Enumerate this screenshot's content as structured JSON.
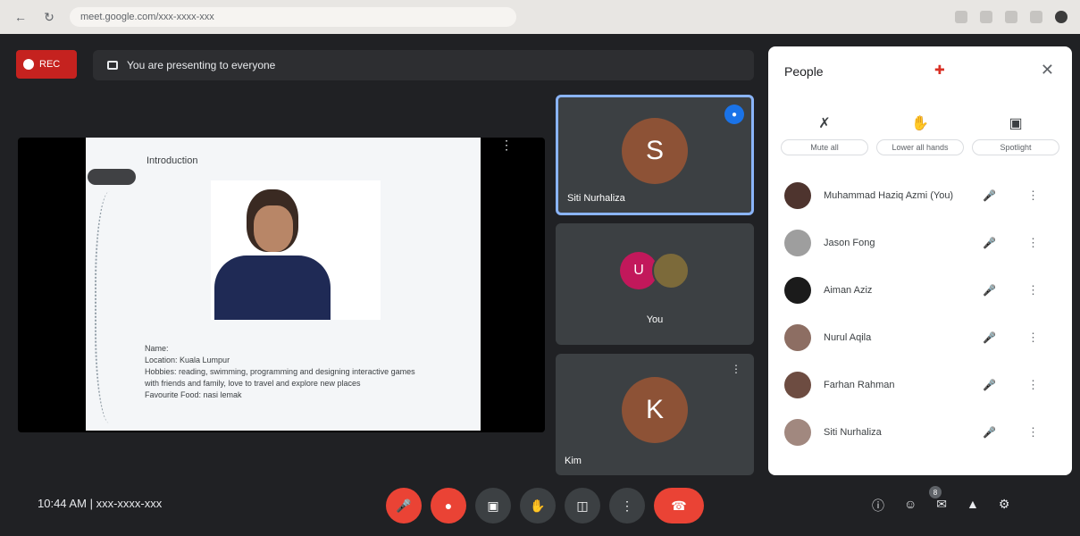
{
  "browser": {
    "url": "meet.google.com/xxx-xxxx-xxx",
    "back_icon": "back-arrow",
    "reload_icon": "reload"
  },
  "meeting": {
    "rec_label": "REC",
    "presenter_banner": "You are presenting to everyone",
    "time": "10:44 AM",
    "code": "xxx-xxxx-xxx",
    "participant_count": "8"
  },
  "stage": {
    "slide_title": "Introduction",
    "slide_lines": [
      "Name:",
      "Location: Kuala Lumpur",
      "Hobbies: reading, swimming, programming and designing interactive games",
      "with friends and family, love to travel and explore new places",
      "Favourite Food: nasi lemak"
    ]
  },
  "tiles": [
    {
      "initial": "S",
      "name": "Siti Nurhaliza",
      "avatar_color": "#8d5236"
    },
    {
      "initials": [
        "U",
        ""
      ],
      "name": "You",
      "avatar_colors": [
        "#c2185b",
        "#7c6a3a"
      ]
    },
    {
      "initial": "K",
      "name": "Kim",
      "avatar_color": "#8d5236"
    }
  ],
  "people_panel": {
    "title": "People",
    "add_icon": "person-add-icon",
    "actions": [
      {
        "icon": "mic-off-icon",
        "label": "Mute all"
      },
      {
        "icon": "hand-icon",
        "label": "Lower all hands"
      },
      {
        "icon": "view-icon",
        "label": "Spotlight"
      }
    ],
    "people": [
      {
        "name": "Muhammad Haziq Azmi (You)",
        "avatar_color": "#4e342e"
      },
      {
        "name": "Jason Fong",
        "avatar_color": "#9e9e9e"
      },
      {
        "name": "Aiman Aziz",
        "avatar_color": "#1b1b1b"
      },
      {
        "name": "Nurul Aqila",
        "avatar_color": "#8d6e63"
      },
      {
        "name": "Farhan Rahman",
        "avatar_color": "#6d4c41"
      },
      {
        "name": "Siti Nurhaliza",
        "avatar_color": "#a1887f"
      }
    ]
  },
  "controls": {
    "mic_label": "Turn on microphone",
    "cam_label": "Turn on camera",
    "captions_label": "Captions",
    "hand_label": "Raise hand",
    "present_label": "Present now",
    "more_label": "More options",
    "leave_label": "Leave call"
  },
  "colors": {
    "background": "#202124",
    "tile": "#3c4043",
    "accent_blue": "#8ab4f8",
    "danger_red": "#ea4335"
  }
}
